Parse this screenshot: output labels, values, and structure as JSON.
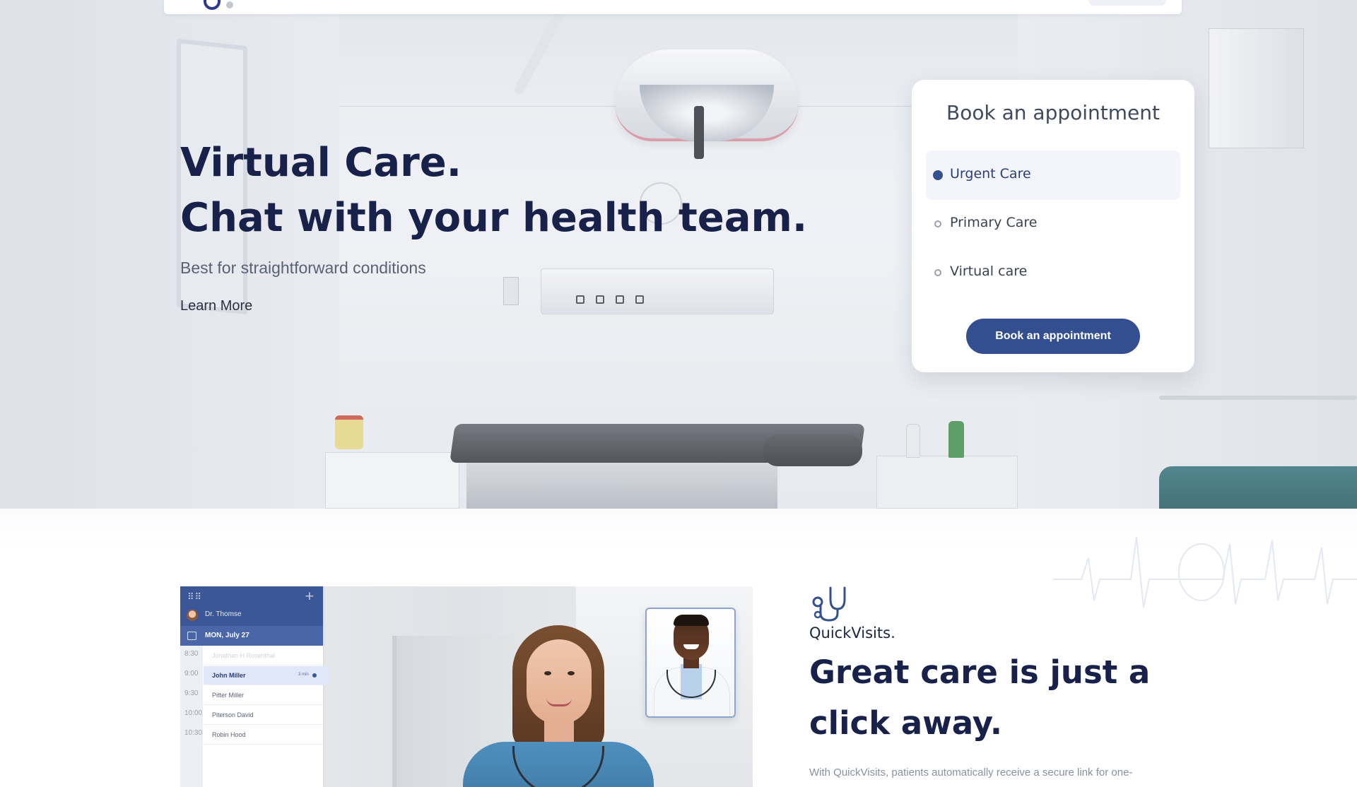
{
  "hero": {
    "title_line1": "Virtual Care.",
    "title_line2": "Chat with your health team.",
    "subtitle": "Best for straightforward conditions",
    "learn_more": "Learn More"
  },
  "booking": {
    "title": "Book an appointment",
    "options": [
      {
        "label": "Urgent Care",
        "selected": true
      },
      {
        "label": "Primary Care",
        "selected": false
      },
      {
        "label": "Virtual care",
        "selected": false
      }
    ],
    "button_label": "Book an appointment"
  },
  "schedule": {
    "doctor": "Dr. Thomse",
    "date": "MON, July 27",
    "rows": [
      {
        "time": "8:30",
        "name": "Jonathan H Rosenthal",
        "faded": true
      },
      {
        "time": "9:00",
        "name": "John Miller",
        "selected": true,
        "tag": "3 min"
      },
      {
        "time": "9:30",
        "name": "Pitter Miller"
      },
      {
        "time": "10:00",
        "name": "Piterson David"
      },
      {
        "time": "10:30",
        "name": "Robin Hood"
      }
    ]
  },
  "quickvisits": {
    "icon": "stethoscope-icon",
    "kicker": "QuickVisits.",
    "title": "Great care is just a click away.",
    "body": "With QuickVisits, patients automatically receive a secure link for one-"
  },
  "colors": {
    "brand_navy": "#17214a",
    "accent_blue": "#344f8f",
    "schedule_header": "#3b5798"
  }
}
